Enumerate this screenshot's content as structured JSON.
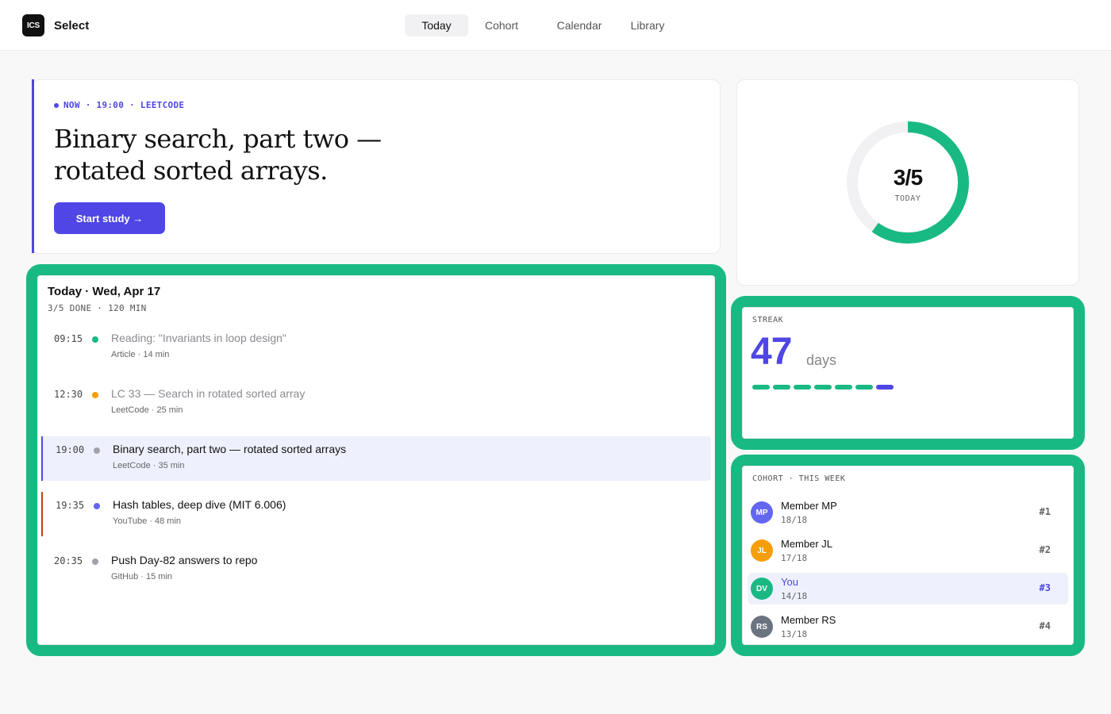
{
  "header": {
    "logo": "ICS",
    "brand": "Select",
    "nav": [
      {
        "label": "Today",
        "active": true
      },
      {
        "label": "Cohort",
        "active": false
      },
      {
        "label": "Calendar",
        "active": false
      },
      {
        "label": "Library",
        "active": false
      }
    ]
  },
  "hero": {
    "kicker": "NOW · 19:00 · LEETCODE",
    "title": "Binary search, part two — rotated sorted arrays.",
    "cta": "Start study →"
  },
  "progress": {
    "value": "3/5",
    "label": "TODAY",
    "done": 3,
    "total": 5,
    "color": "#19b984"
  },
  "schedule": {
    "title": "Today · Wed, Apr 17",
    "summary": "3/5 DONE · 120 MIN",
    "items": [
      {
        "time": "09:15",
        "title": "Reading: \"Invariants in loop design\"",
        "meta": "Article · 14 min",
        "status": "done",
        "dot": "#19b984"
      },
      {
        "time": "12:30",
        "title": "LC 33 — Search in rotated sorted array",
        "meta": "LeetCode · 25 min",
        "status": "done",
        "dot": "#f59e0b"
      },
      {
        "time": "19:00",
        "title": "Binary search, part two — rotated sorted arrays",
        "meta": "LeetCode · 35 min",
        "status": "current",
        "dot": "#a1a1aa"
      },
      {
        "time": "19:35",
        "title": "Hash tables, deep dive (MIT 6.006)",
        "meta": "YouTube · 48 min",
        "status": "flagged",
        "dot": "#6366f1"
      },
      {
        "time": "20:35",
        "title": "Push Day-82 answers to repo",
        "meta": "GitHub · 15 min",
        "status": "upcoming",
        "dot": "#a1a1aa"
      }
    ]
  },
  "streak": {
    "label": "STREAK",
    "value": "47",
    "unit": "days",
    "week": [
      "done",
      "done",
      "done",
      "done",
      "done",
      "done",
      "today"
    ]
  },
  "cohort": {
    "label": "COHORT · THIS WEEK",
    "members": [
      {
        "initials": "MP",
        "name": "Member MP",
        "score": "18/18",
        "rank": "#1",
        "color": "#6366f1",
        "me": false
      },
      {
        "initials": "JL",
        "name": "Member JL",
        "score": "17/18",
        "rank": "#2",
        "color": "#f59e0b",
        "me": false
      },
      {
        "initials": "DV",
        "name": "You",
        "score": "14/18",
        "rank": "#3",
        "color": "#19b984",
        "me": true
      },
      {
        "initials": "RS",
        "name": "Member RS",
        "score": "13/18",
        "rank": "#4",
        "color": "#6b7280",
        "me": false
      }
    ]
  }
}
